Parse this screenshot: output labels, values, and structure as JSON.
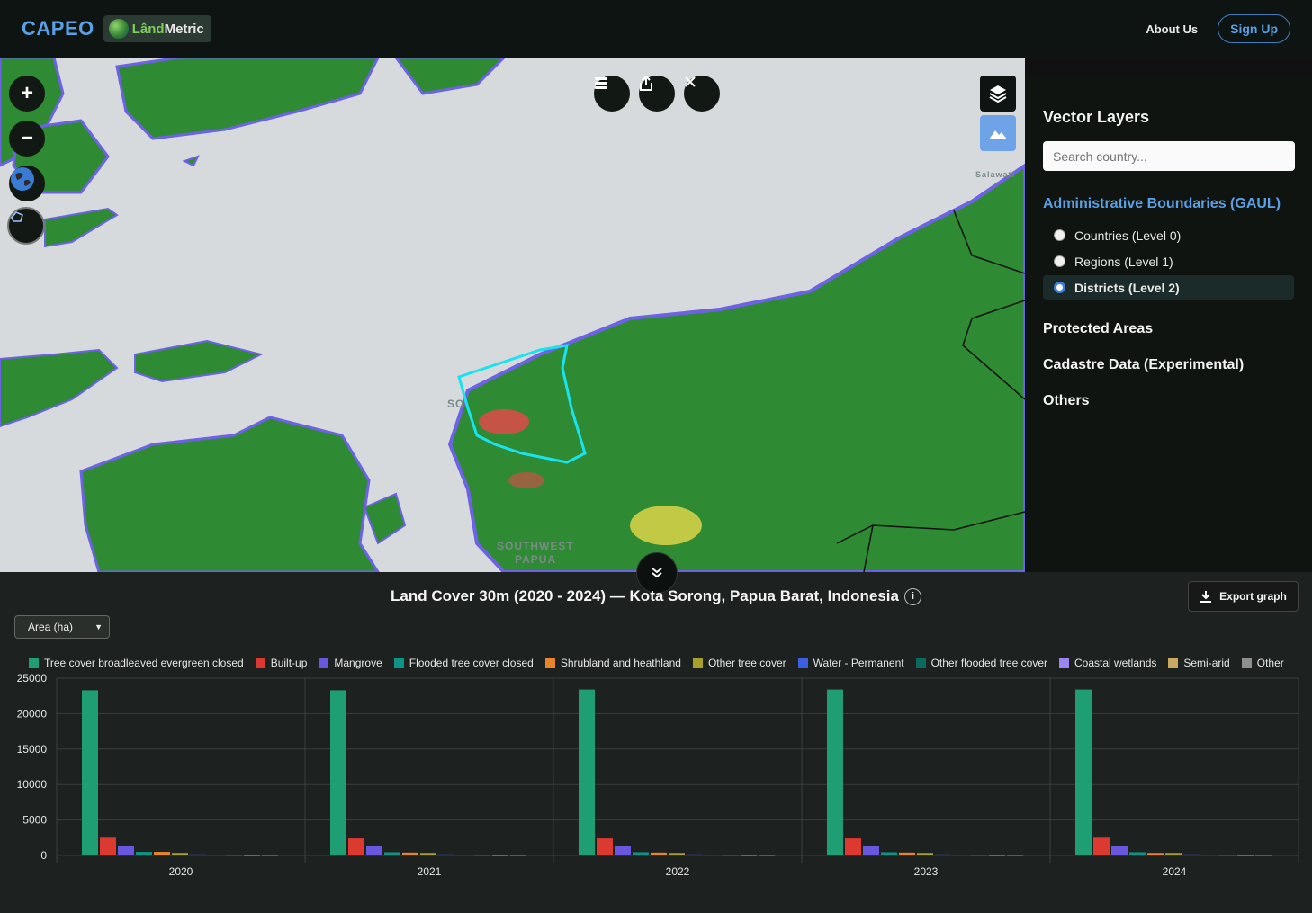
{
  "header": {
    "brand": "CAPEO",
    "logo_text_a": "Lând",
    "logo_text_b": "Metric",
    "about_label": "About Us",
    "signup_label": "Sign Up"
  },
  "map": {
    "zoom_in": "+",
    "zoom_out": "−",
    "labels": {
      "city": "SO",
      "province_1": "SOUTHWEST",
      "province_2": "PAPUA",
      "corner": "Salawati"
    },
    "colors": {
      "sea": "#d7dadd",
      "forest": "#2e8b34",
      "mangrove": "#6d62e6",
      "builtup": "#e04a4a",
      "selection": "#19e3f0",
      "shrub": "#e6d84a"
    }
  },
  "panel": {
    "title": "Vector Layers",
    "search_placeholder": "Search country...",
    "admin_title": "Administrative Boundaries (GAUL)",
    "admin_options": [
      {
        "label": "Countries (Level 0)",
        "selected": false
      },
      {
        "label": "Regions (Level 1)",
        "selected": false
      },
      {
        "label": "Districts (Level 2)",
        "selected": true
      }
    ],
    "sections": [
      "Protected Areas",
      "Cadastre Data (Experimental)",
      "Others"
    ]
  },
  "bottom": {
    "title": "Land Cover 30m (2020 - 2024) — Kota Sorong, Papua Barat, Indonesia",
    "info_icon": "i",
    "export_label": "Export graph",
    "metric_select": "Area (ha)"
  },
  "chart_data": {
    "type": "bar",
    "title": "Land Cover 30m (2020 - 2024) — Kota Sorong, Papua Barat, Indonesia",
    "xlabel": "",
    "ylabel": "",
    "ylim": [
      0,
      25000
    ],
    "yticks": [
      0,
      5000,
      10000,
      15000,
      20000,
      25000
    ],
    "categories": [
      "2020",
      "2021",
      "2022",
      "2023",
      "2024"
    ],
    "legend_position": "top",
    "series": [
      {
        "name": "Tree cover broadleaved evergreen closed",
        "color": "#1f9e74",
        "values": [
          23300,
          23300,
          23400,
          23400,
          23400
        ]
      },
      {
        "name": "Built-up",
        "color": "#dc3a30",
        "values": [
          2500,
          2400,
          2400,
          2400,
          2500
        ]
      },
      {
        "name": "Mangrove",
        "color": "#6a57e0",
        "values": [
          1300,
          1300,
          1300,
          1300,
          1300
        ]
      },
      {
        "name": "Flooded tree cover closed",
        "color": "#0e9486",
        "values": [
          500,
          450,
          450,
          450,
          450
        ]
      },
      {
        "name": "Shrubland and heathland",
        "color": "#e8852a",
        "values": [
          500,
          400,
          400,
          400,
          350
        ]
      },
      {
        "name": "Other tree cover",
        "color": "#a8a125",
        "values": [
          350,
          350,
          350,
          350,
          350
        ]
      },
      {
        "name": "Water - Permanent",
        "color": "#3d5ee0",
        "values": [
          150,
          150,
          150,
          150,
          150
        ]
      },
      {
        "name": "Other flooded tree cover",
        "color": "#0a6b5d",
        "values": [
          100,
          100,
          100,
          100,
          100
        ]
      },
      {
        "name": "Coastal wetlands",
        "color": "#9b86f0",
        "values": [
          100,
          100,
          100,
          100,
          100
        ]
      },
      {
        "name": "Semi-arid",
        "color": "#c9a862",
        "values": [
          60,
          60,
          60,
          60,
          60
        ]
      },
      {
        "name": "Other",
        "color": "#8e8e8e",
        "values": [
          60,
          60,
          60,
          60,
          60
        ]
      }
    ]
  }
}
